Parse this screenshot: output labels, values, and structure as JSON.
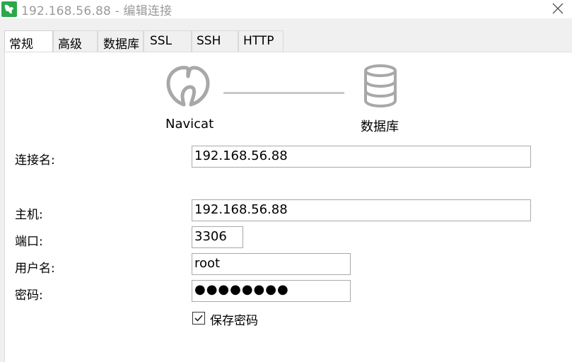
{
  "window": {
    "title": "192.168.56.88 - 编辑连接"
  },
  "tabs": [
    {
      "label": "常规",
      "active": true
    },
    {
      "label": "高级",
      "active": false
    },
    {
      "label": "数据库",
      "active": false
    },
    {
      "label": "SSL",
      "active": false
    },
    {
      "label": "SSH",
      "active": false
    },
    {
      "label": "HTTP",
      "active": false
    }
  ],
  "diagram": {
    "left_label": "Navicat",
    "right_label": "数据库"
  },
  "form": {
    "connection_name": {
      "label": "连接名:",
      "value": "192.168.56.88"
    },
    "host": {
      "label": "主机:",
      "value": "192.168.56.88"
    },
    "port": {
      "label": "端口:",
      "value": "3306"
    },
    "username": {
      "label": "用户名:",
      "value": "root"
    },
    "password": {
      "label": "密码:",
      "value": "●●●●●●●●"
    },
    "save_password": {
      "label": "保存密码",
      "checked": true
    }
  },
  "icons": {
    "app": "navicat-app-icon",
    "close": "close-icon",
    "navicat_logo": "navicat-logo-icon",
    "database": "database-icon",
    "check": "checkmark-icon"
  },
  "colors": {
    "window_bg": "#f0f0f0",
    "panel_bg": "#ffffff",
    "app_icon_green": "#2aa84a",
    "title_text": "#9a9a9a",
    "icon_gray": "#a8a8a8"
  }
}
